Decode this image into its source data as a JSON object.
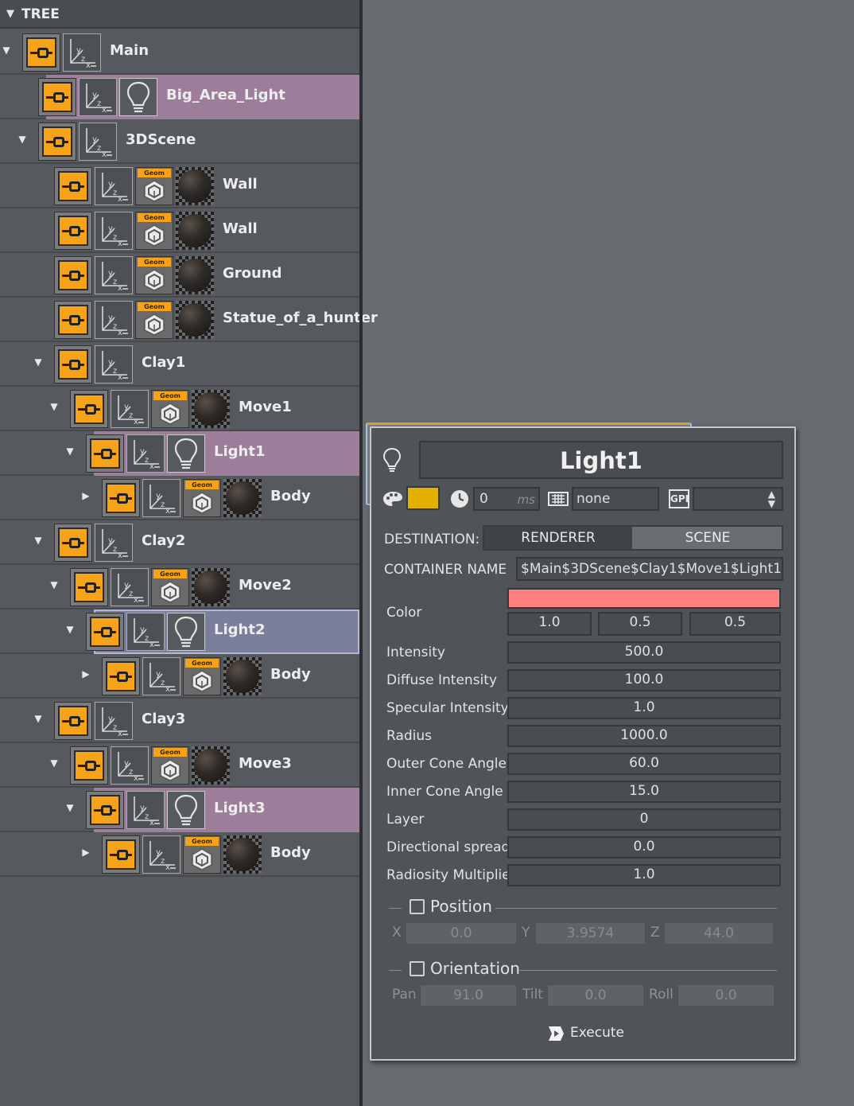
{
  "tree": {
    "header": "TREE",
    "rows": [
      {
        "label": "Main"
      },
      {
        "label": "Big_Area_Light"
      },
      {
        "label": "3DScene"
      },
      {
        "label": "Wall"
      },
      {
        "label": "Wall"
      },
      {
        "label": "Ground"
      },
      {
        "label": "Statue_of_a_hunter"
      },
      {
        "label": "Clay1"
      },
      {
        "label": "Move1"
      },
      {
        "label": "Light1"
      },
      {
        "label": "Body"
      },
      {
        "label": "Clay2"
      },
      {
        "label": "Move2"
      },
      {
        "label": "Light2"
      },
      {
        "label": "Body"
      },
      {
        "label": "Clay3"
      },
      {
        "label": "Move3"
      },
      {
        "label": "Light3"
      },
      {
        "label": "Body"
      }
    ],
    "geom_tag": "Geom"
  },
  "panel": {
    "title": "Light1",
    "swatch_color": "#e2b000",
    "time_value": "0",
    "time_unit": "ms",
    "keyboard_value": "none",
    "gpi_label": "GPI",
    "destination_label": "DESTINATION:",
    "destination_options": [
      "RENDERER",
      "SCENE"
    ],
    "container_label": "CONTAINER NAME",
    "container_value": "$Main$3DScene$Clay1$Move1$Light1",
    "color_label": "Color",
    "color_swatch": "#ff8080",
    "color_values": [
      "1.0",
      "0.5",
      "0.5"
    ],
    "props": [
      {
        "label": "Intensity",
        "value": "500.0"
      },
      {
        "label": "Diffuse Intensity",
        "value": "100.0"
      },
      {
        "label": "Specular Intensity",
        "value": "1.0"
      },
      {
        "label": "Radius",
        "value": "1000.0"
      },
      {
        "label": "Outer Cone Angle",
        "value": "60.0"
      },
      {
        "label": "Inner Cone Angle",
        "value": "15.0"
      },
      {
        "label": "Layer",
        "value": "0"
      },
      {
        "label": "Directional spread",
        "value": "0.0"
      },
      {
        "label": "Radiosity Multiplier",
        "value": "1.0"
      }
    ],
    "position": {
      "label": "Position",
      "x_label": "X",
      "x": "0.0",
      "y_label": "Y",
      "y": "3.9574",
      "z_label": "Z",
      "z": "44.0"
    },
    "orientation": {
      "label": "Orientation",
      "pan_label": "Pan",
      "pan": "91.0",
      "tilt_label": "Tilt",
      "tilt": "0.0",
      "roll_label": "Roll",
      "roll": "0.0"
    },
    "execute_label": "Execute"
  }
}
